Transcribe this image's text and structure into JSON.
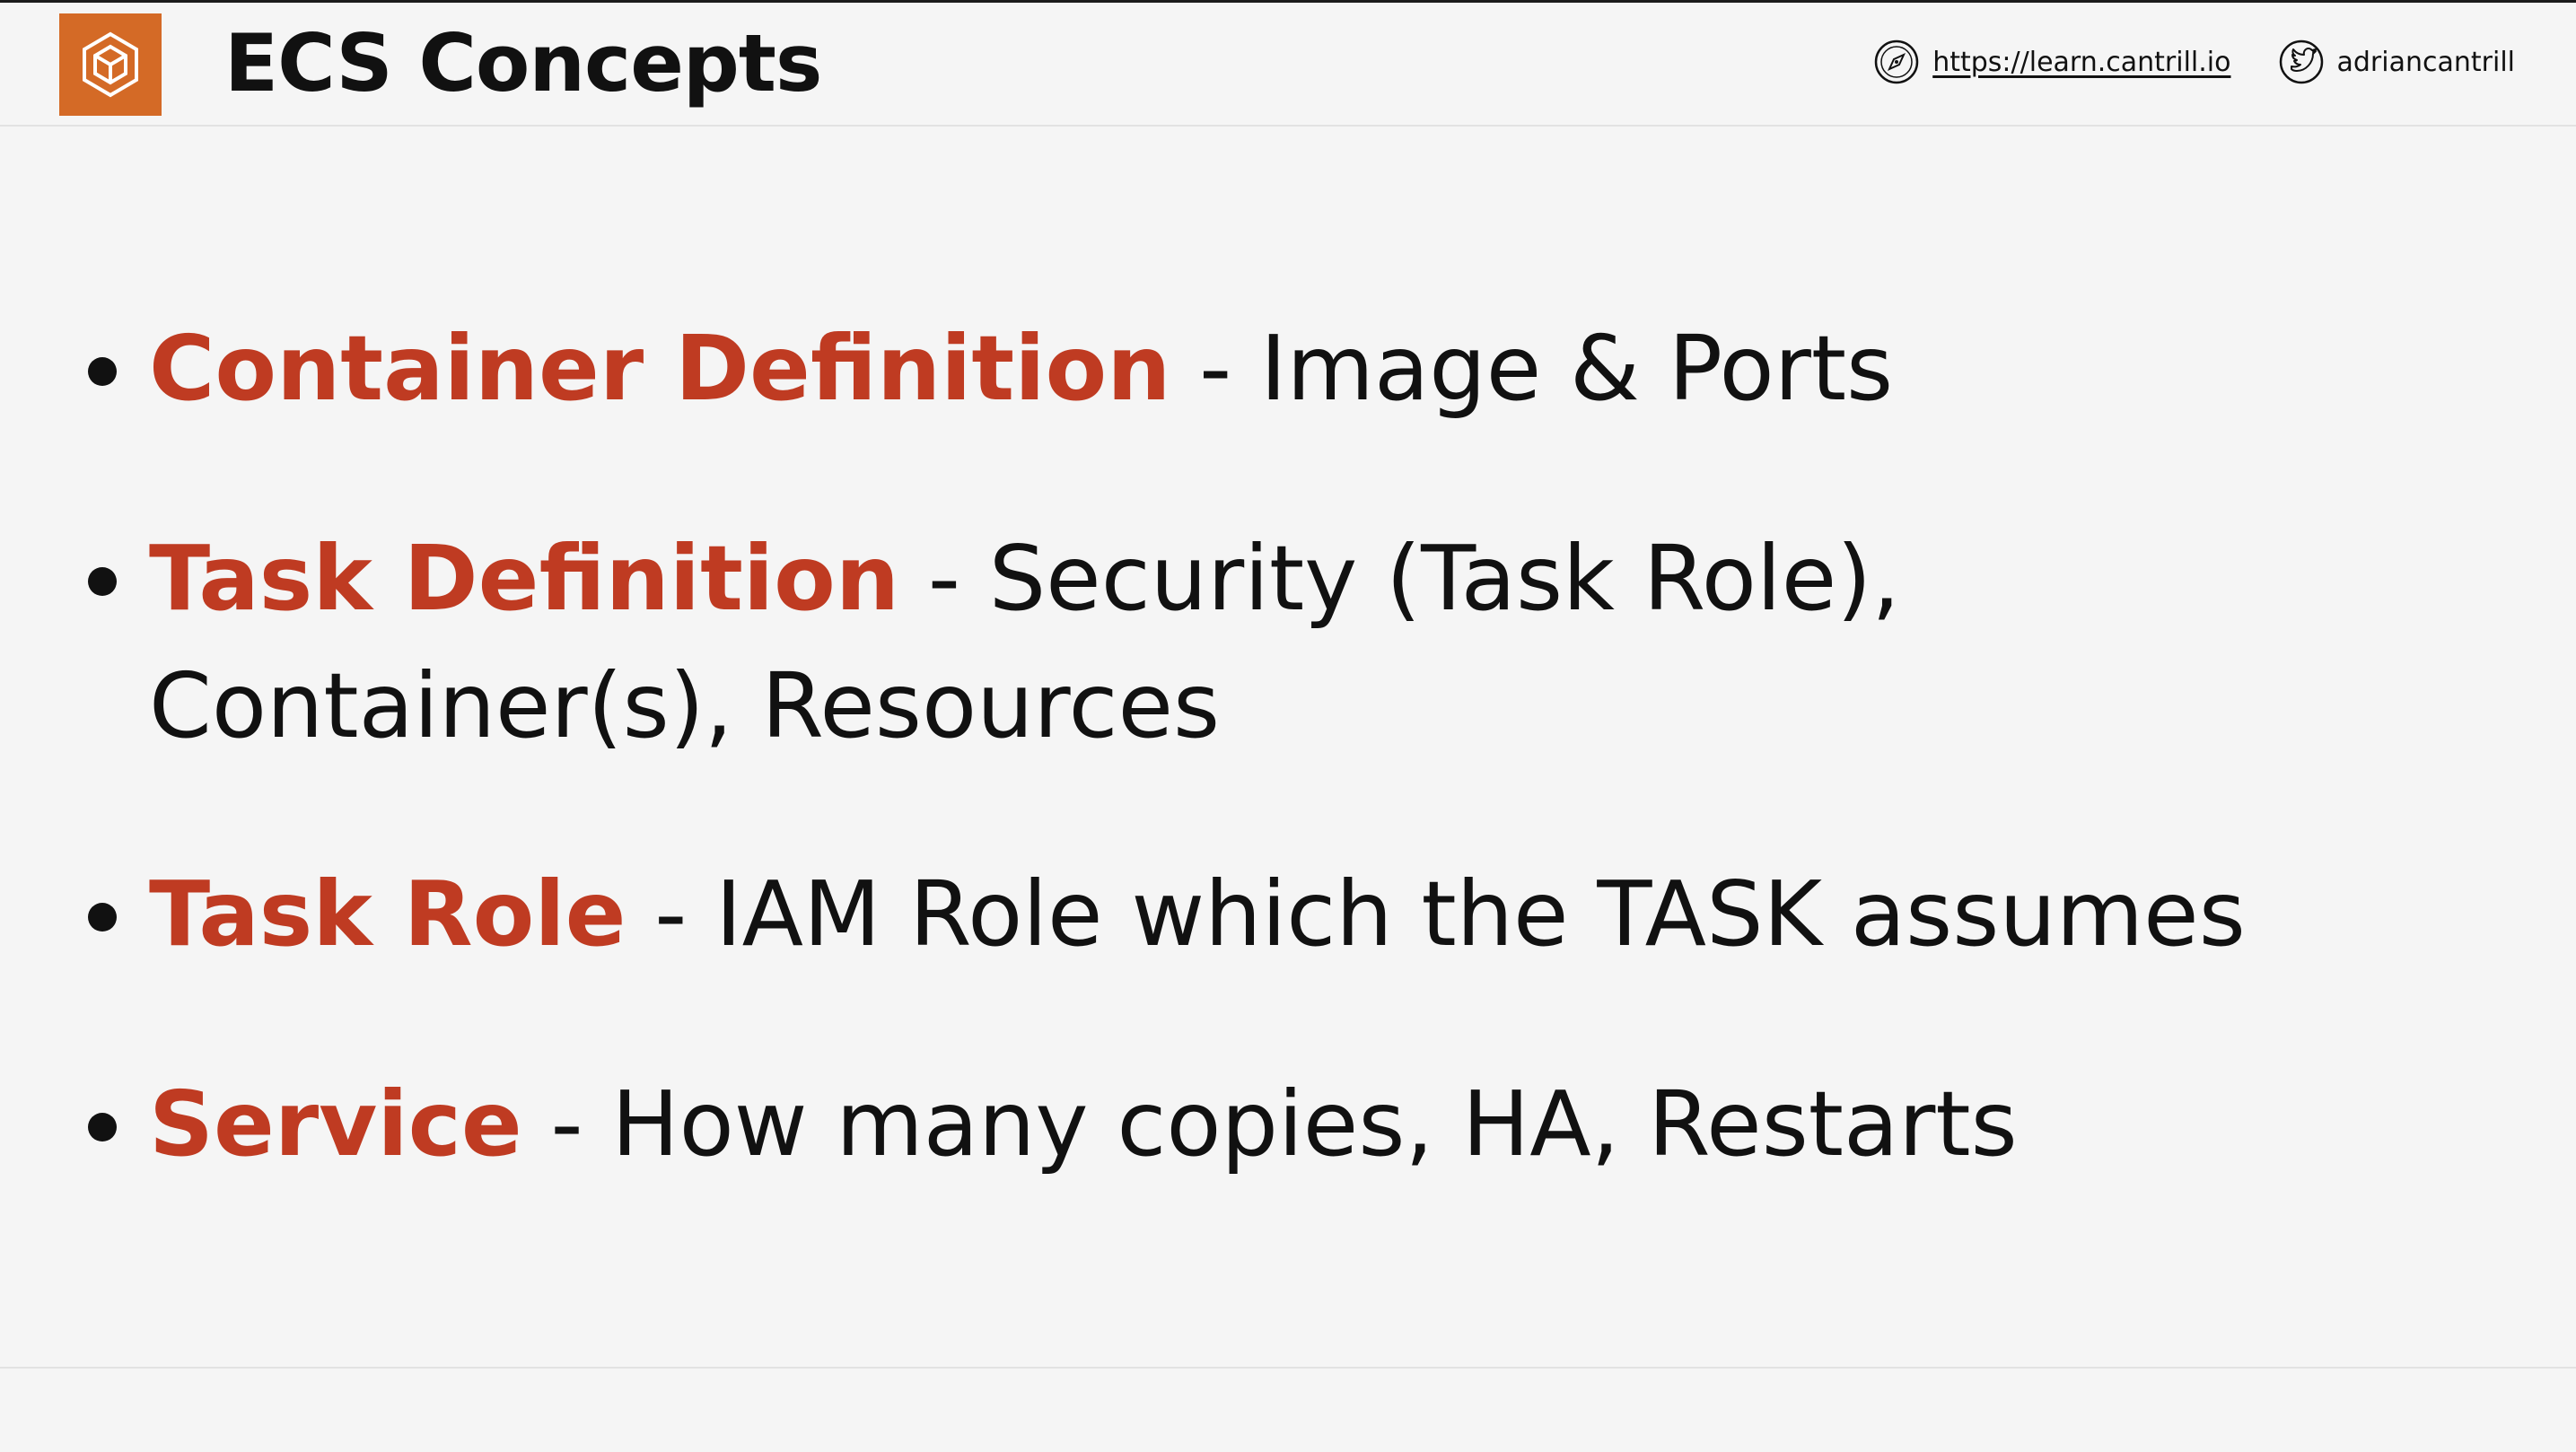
{
  "header": {
    "title": "ECS Concepts",
    "logo_icon": "ecs-container-hexagon-icon",
    "logo_color": "#d46a26",
    "website_icon": "compass-icon",
    "website_url": "https://learn.cantrill.io",
    "twitter_icon": "twitter-bird-icon",
    "twitter_handle": "adriancantrill"
  },
  "colors": {
    "accent": "#bf3b22",
    "text": "#111111",
    "background": "#f5f5f5"
  },
  "bullets": [
    {
      "term": "Container Definition",
      "description": " - Image & Ports"
    },
    {
      "term": "Task Definition",
      "description": " - Security (Task Role), Container(s), Resources"
    },
    {
      "term": "Task Role",
      "description": " - IAM Role which the TASK assumes"
    },
    {
      "term": "Service",
      "description": " - How many copies, HA, Restarts"
    }
  ]
}
